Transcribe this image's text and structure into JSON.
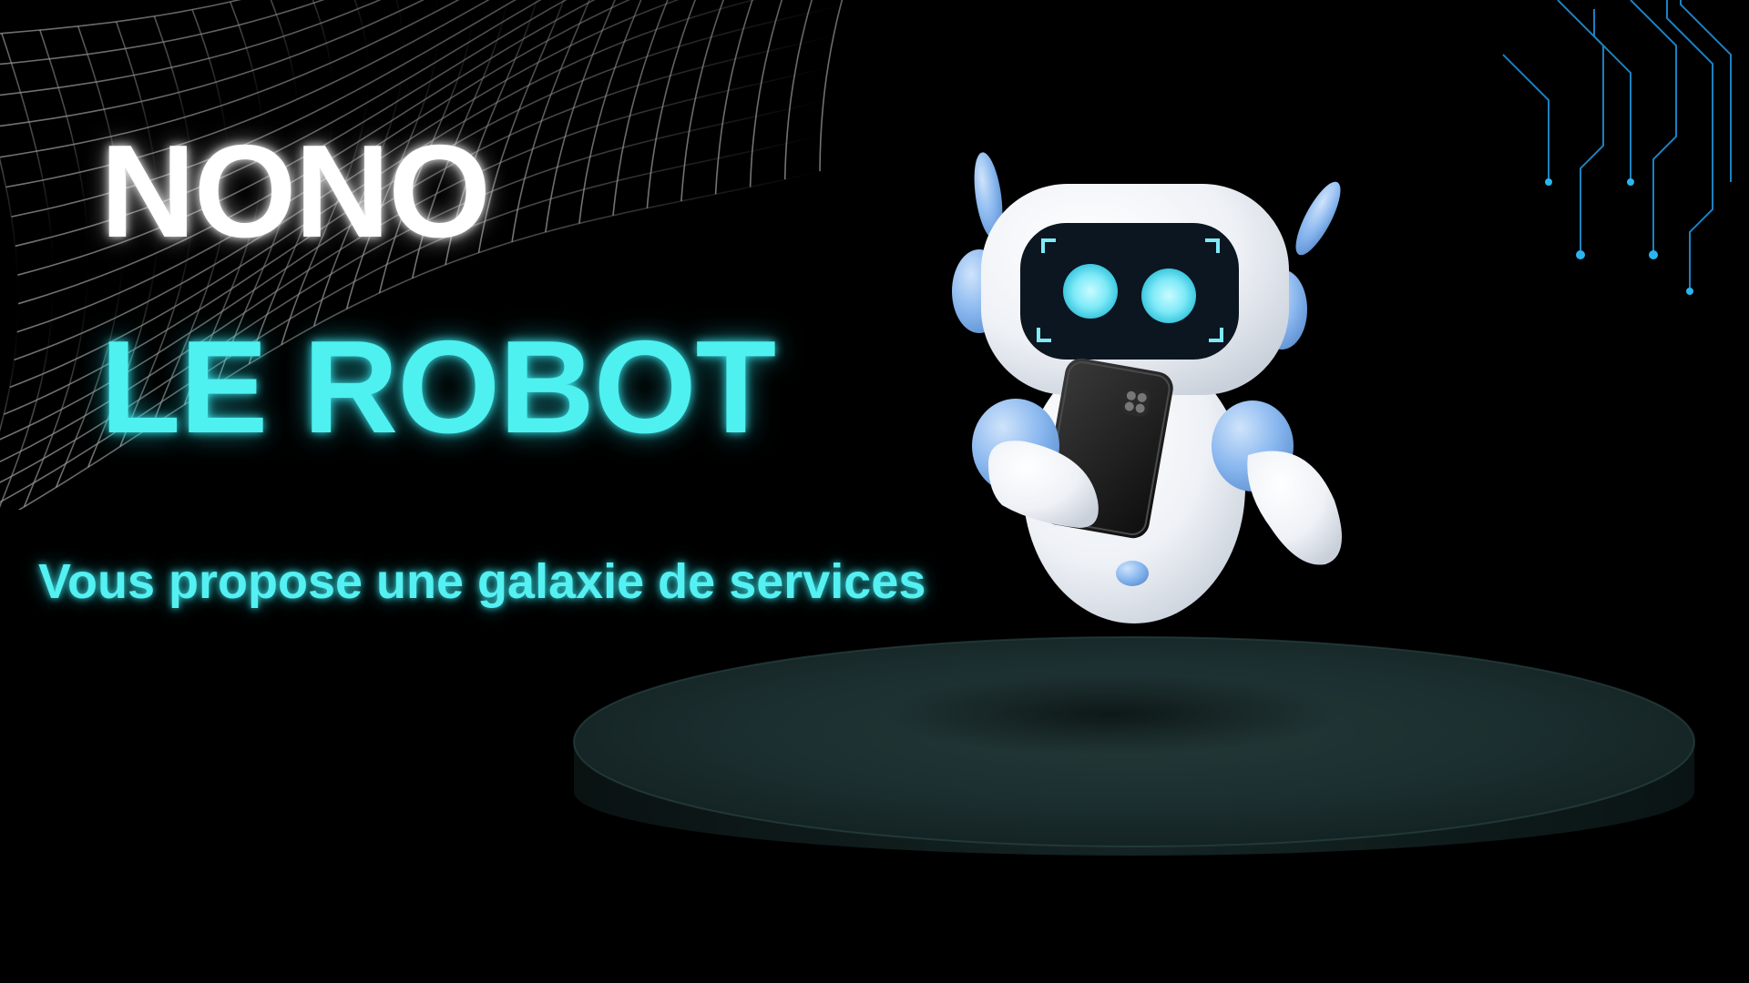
{
  "title": {
    "line1": "NONO",
    "line2": "LE ROBOT"
  },
  "tagline": "Vous propose une galaxie de services",
  "colors": {
    "background": "#000000",
    "title_primary": "#ffffff",
    "accent_cyan": "#4ff0f0",
    "robot_body": "#f2f4f8",
    "robot_accent_blue": "#8ab8ef",
    "robot_eyes": "#6fe6f5",
    "podium": "#1a2b2b"
  },
  "decorations": {
    "mesh": "wireframe-wave-grid",
    "circuit": "circuit-lines",
    "robot": "robot-mascot-holding-tablet",
    "podium": "cylindrical-pedestal"
  }
}
